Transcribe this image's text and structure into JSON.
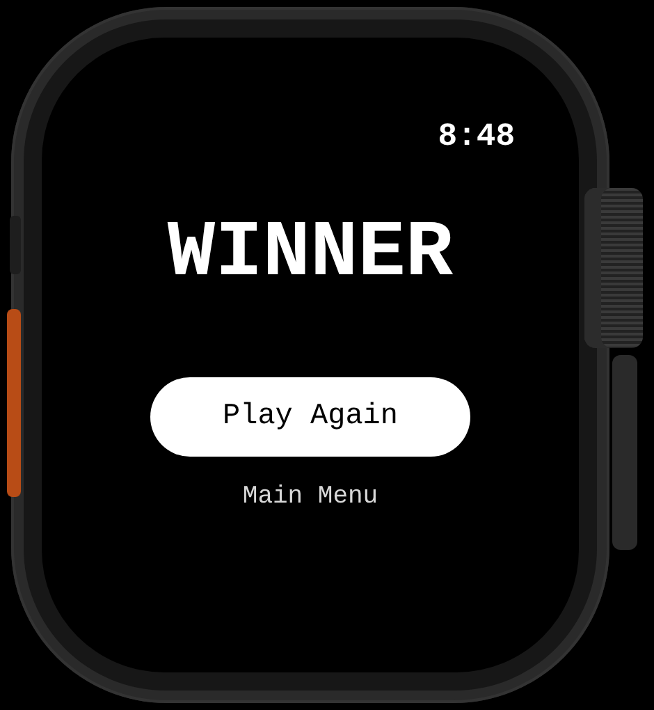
{
  "status_bar": {
    "time": "8:48"
  },
  "title": "WINNER",
  "buttons": [
    {
      "label": "Play Again",
      "kind": "primary"
    },
    {
      "label": "Main Menu",
      "kind": "plain"
    }
  ]
}
